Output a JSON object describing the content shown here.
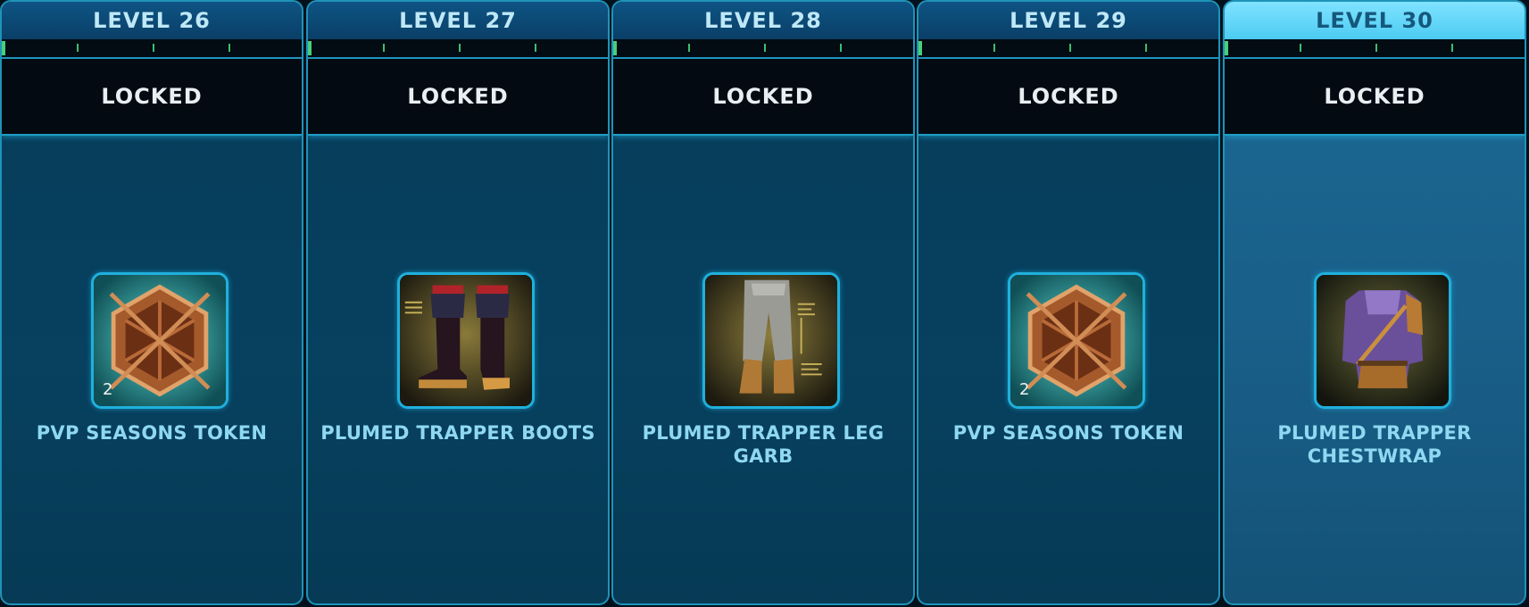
{
  "levels": [
    {
      "label": "LEVEL 26",
      "status": "LOCKED",
      "reward": "PVP SEASONS TOKEN",
      "icon": "pvp-token-icon",
      "quantity": "2"
    },
    {
      "label": "LEVEL 27",
      "status": "LOCKED",
      "reward": "PLUMED TRAPPER BOOTS",
      "icon": "boots-icon",
      "quantity": ""
    },
    {
      "label": "LEVEL 28",
      "status": "LOCKED",
      "reward": "PLUMED TRAPPER LEG GARB",
      "icon": "leg-garb-icon",
      "quantity": ""
    },
    {
      "label": "LEVEL 29",
      "status": "LOCKED",
      "reward": "PVP SEASONS TOKEN",
      "icon": "pvp-token-icon",
      "quantity": "2"
    },
    {
      "label": "LEVEL 30",
      "status": "LOCKED",
      "reward": "PLUMED TRAPPER CHESTWRAP",
      "icon": "chestwrap-icon",
      "quantity": ""
    }
  ],
  "highlighted_level": "LEVEL 30",
  "colors": {
    "accent": "#1f93b8",
    "progress_tick": "#3bbf6d",
    "header_active": "#6fd9f8",
    "reward_text": "#8fd8f2"
  }
}
